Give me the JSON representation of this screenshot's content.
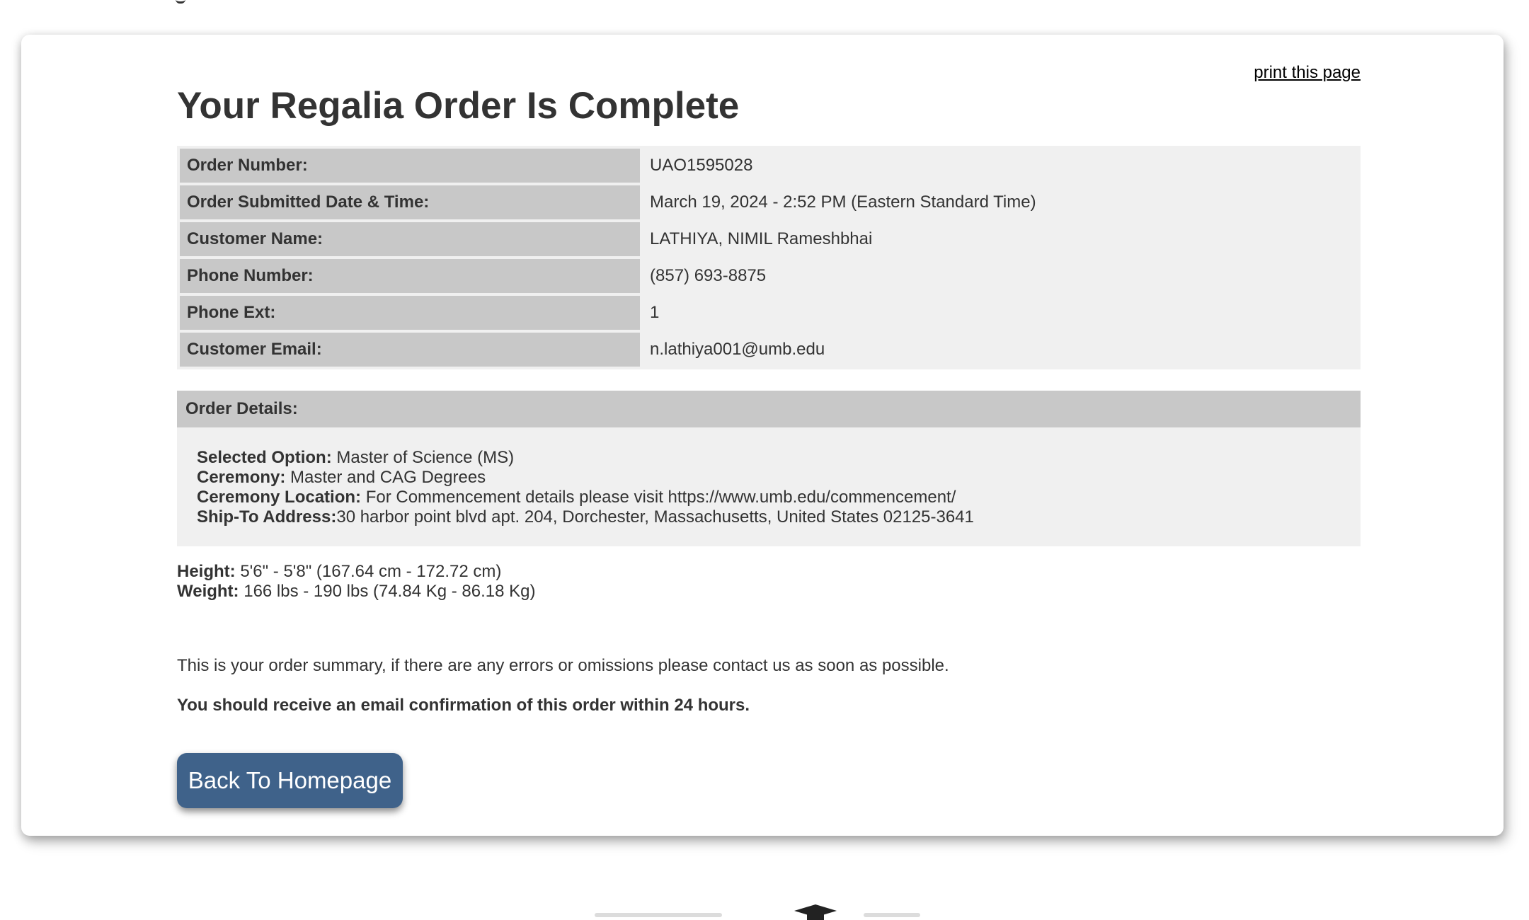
{
  "header": {
    "print_link": "print this page",
    "title": "Your Regalia Order Is Complete"
  },
  "order_info": [
    {
      "label": "Order Number:",
      "value": "UAO1595028"
    },
    {
      "label": "Order Submitted Date & Time:",
      "value": "March 19, 2024 - 2:52 PM (Eastern Standard Time)"
    },
    {
      "label": "Customer Name:",
      "value": "LATHIYA, NIMIL Rameshbhai"
    },
    {
      "label": "Phone Number:",
      "value": "(857) 693-8875"
    },
    {
      "label": "Phone Ext:",
      "value": "1"
    },
    {
      "label": "Customer Email:",
      "value": "n.lathiya001@umb.edu"
    }
  ],
  "order_details": {
    "header": "Order Details:",
    "selected_option_label": "Selected Option:",
    "selected_option_value": " Master of Science (MS)",
    "ceremony_label": "Ceremony:",
    "ceremony_value": " Master and CAG Degrees",
    "location_label": "Ceremony Location:",
    "location_value": " For Commencement details please visit https://www.umb.edu/commencement/",
    "ship_to_label": "Ship-To Address:",
    "ship_to_value": "30 harbor point blvd apt. 204, Dorchester, Massachusetts, United States 02125-3641"
  },
  "measurements": {
    "height_label": "Height:",
    "height_value": " 5'6\" - 5'8\" (167.64 cm - 172.72 cm)",
    "weight_label": "Weight:",
    "weight_value": " 166 lbs - 190 lbs (74.84 Kg - 86.18 Kg)"
  },
  "messages": {
    "summary": "This is your order summary, if there are any errors or omissions please contact us as soon as possible.",
    "confirmation": "You should receive an email confirmation of this order within 24 hours."
  },
  "actions": {
    "back_button": "Back To Homepage"
  },
  "colors": {
    "button": "#3f628a",
    "label_cell": "#c8c8c8",
    "table_bg": "#f0f0f0",
    "text": "#333333"
  },
  "icons": {
    "footer": "graduation-cap-icon"
  }
}
